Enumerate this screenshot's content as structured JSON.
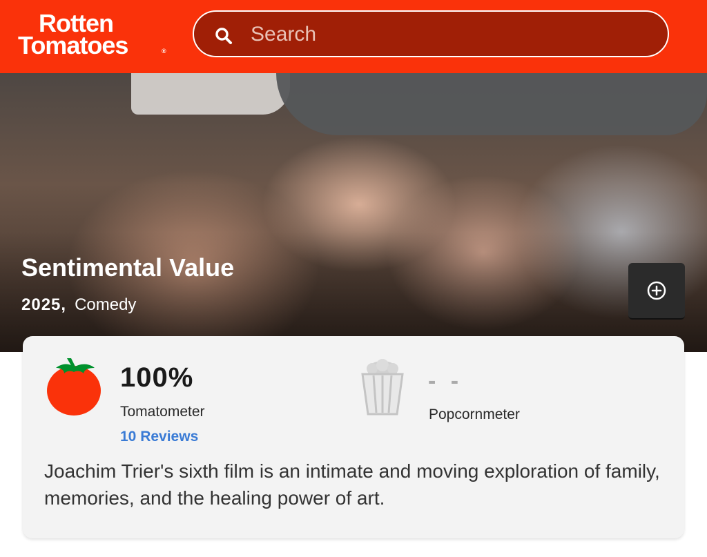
{
  "header": {
    "logo_line1": "Rotten",
    "logo_line2": "Tomatoes",
    "logo_reg": "®",
    "search_placeholder": "Search",
    "brand_color": "#fa320a"
  },
  "movie": {
    "title": "Sentimental Value",
    "year": "2025,",
    "genre": "Comedy",
    "add_icon": "plus-circle-icon"
  },
  "scores": {
    "tomatometer_value": "100%",
    "tomatometer_label": "Tomatometer",
    "reviews_link": "10 Reviews",
    "tomato_icon": "fresh-tomato-icon",
    "popcornmeter_value": "- -",
    "popcornmeter_label": "Popcornmeter",
    "popcorn_icon": "popcorn-bucket-icon",
    "link_color": "#3a7bd5"
  },
  "consensus": "Joachim Trier's sixth film is an intimate and moving exploration of family, memories, and the healing power of art."
}
